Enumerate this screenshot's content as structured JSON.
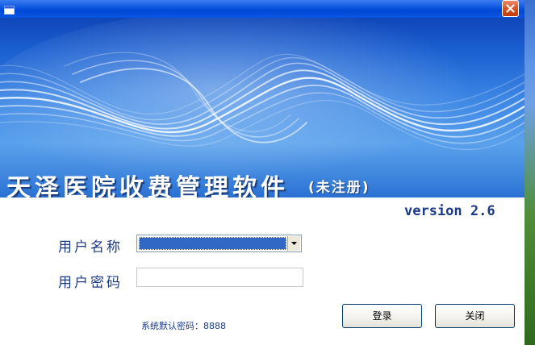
{
  "window": {
    "title": "",
    "close_glyph": "✕"
  },
  "banner": {
    "title": "天泽医院收费管理软件",
    "subtitle": "(未注册)"
  },
  "version": "version 2.6",
  "form": {
    "username_label": "用户名称",
    "username_value": "",
    "password_label": "用户密码",
    "password_value": "",
    "default_password_hint": "系统默认密码：8888"
  },
  "buttons": {
    "login": "登录",
    "close": "关闭"
  },
  "colors": {
    "title_bar": "#0a54e0",
    "banner": "#3c86e4",
    "label_text": "#1b3a86",
    "selection": "#3168c6",
    "close_button": "#d9501c"
  },
  "icons": {
    "app": "window-icon",
    "close": "close-icon",
    "dropdown": "chevron-down-icon"
  }
}
